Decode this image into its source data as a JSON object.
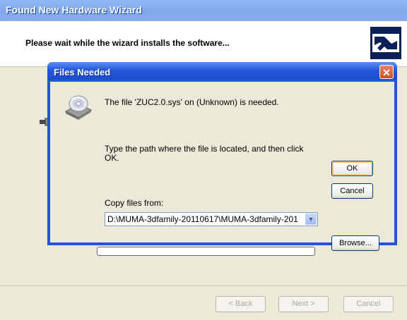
{
  "wizard": {
    "title": "Found New Hardware Wizard",
    "heading": "Please wait while the wizard installs the software...",
    "progress": 0,
    "buttons": {
      "back": "< Back",
      "next": "Next >",
      "cancel": "Cancel"
    }
  },
  "dialog": {
    "title": "Files Needed",
    "close_glyph": "✕",
    "message_needed": "The file 'ZUC2.0.sys' on (Unknown) is needed.",
    "message_type_path": "Type the path where the file is located, and then click OK.",
    "copy_files_label": "Copy files from:",
    "copy_files_value": "D:\\MUMA-3dfamily-20110617\\MUMA-3dfamily-201",
    "dropdown_glyph": "▼",
    "buttons": {
      "ok": "OK",
      "cancel": "Cancel",
      "browse": "Browse..."
    }
  },
  "icons": {
    "dialog_icon": "cd-disc-drive-icon",
    "wizard_icon": "hardware-wizard-logo-icon",
    "device_icon": "usb-connector-icon"
  },
  "colors": {
    "titlebar_blue": "#2453d7",
    "dialog_face": "#ece9d8",
    "close_red": "#d44b22"
  }
}
